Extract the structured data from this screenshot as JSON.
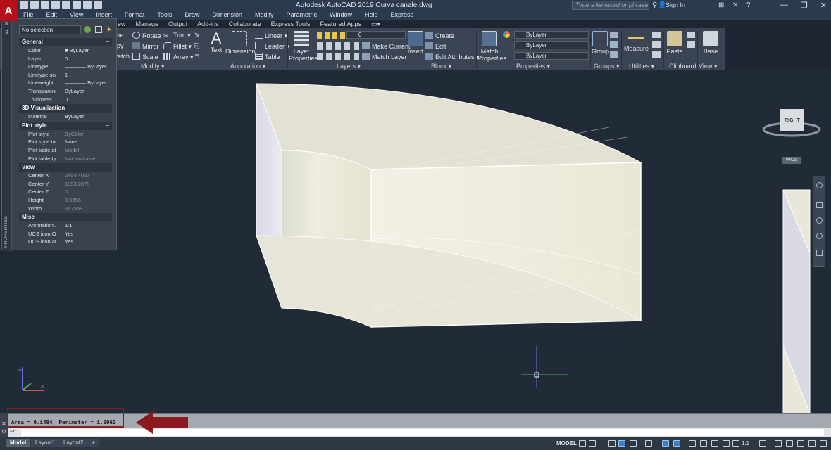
{
  "app": {
    "title": "Autodesk AutoCAD 2019    Curva canale.dwg",
    "logo_letter": "A",
    "search_placeholder": "Type a keyword or phrase",
    "signin_label": "Sign In"
  },
  "menu": [
    "File",
    "Edit",
    "View",
    "Insert",
    "Format",
    "Tools",
    "Draw",
    "Dimension",
    "Modify",
    "Parametric",
    "Window",
    "Help",
    "Express"
  ],
  "ribbon_tabs": [
    "ew",
    "Manage",
    "Output",
    "Add-ins",
    "Collaborate",
    "Express Tools",
    "Featured Apps"
  ],
  "ribbon": {
    "modify": {
      "title": "Modify ▾",
      "items": [
        "ve",
        "Rotate",
        "Trim ▾",
        "py",
        "Mirror",
        "Fillet ▾",
        "retch",
        "Scale",
        "Array ▾"
      ]
    },
    "annotation": {
      "title": "Annotation ▾",
      "text_label": "Text",
      "dimension_label": "Dimension",
      "linear_label": "Linear ▾",
      "leader_label": "Leader ▾",
      "table_label": "Table"
    },
    "layers": {
      "title": "Layers ▾",
      "layer_properties_label": "Layer Properties",
      "current_layer": "0",
      "make_current_label": "Make Current",
      "match_layer_label": "Match Layer"
    },
    "block": {
      "title": "Block ▾",
      "insert_label": "Insert",
      "create_label": "Create",
      "edit_label": "Edit",
      "edit_attributes_label": "Edit Attributes ▾"
    },
    "properties": {
      "title": "Properties ▾",
      "match_properties_label": "Match Properties",
      "color_value": "ByLayer",
      "linetype_value": "ByLayer",
      "lineweight_value": "ByLayer"
    },
    "groups": {
      "title": "Groups ▾",
      "group_label": "Group"
    },
    "utilities": {
      "title": "Utilities ▾",
      "measure_label": "Measure"
    },
    "clipboard": {
      "title": "Clipboard",
      "paste_label": "Paste"
    },
    "view": {
      "title": "View ▾",
      "base_label": "Base"
    }
  },
  "properties_palette": {
    "selection": "No selection",
    "side_label": "PROPERTIES",
    "sections": [
      {
        "title": "General",
        "rows": [
          {
            "k": "Color",
            "v": "■ ByLayer",
            "dim": false
          },
          {
            "k": "Layer",
            "v": "0",
            "dim": false
          },
          {
            "k": "Linetype",
            "v": "———— ByLayer",
            "dim": false
          },
          {
            "k": "Linetype sca...",
            "v": "1",
            "dim": false
          },
          {
            "k": "Lineweight",
            "v": "———— ByLayer",
            "dim": false
          },
          {
            "k": "Transparency",
            "v": "ByLayer",
            "dim": false
          },
          {
            "k": "Thickness",
            "v": "0",
            "dim": false
          }
        ]
      },
      {
        "title": "3D Visualization",
        "rows": [
          {
            "k": "Material",
            "v": "ByLayer",
            "dim": false
          }
        ]
      },
      {
        "title": "Plot style",
        "rows": [
          {
            "k": "Plot style",
            "v": "ByColor",
            "dim": true
          },
          {
            "k": "Plot style ta...",
            "v": "None",
            "dim": false
          },
          {
            "k": "Plot table at...",
            "v": "Model",
            "dim": true
          },
          {
            "k": "Plot table ty...",
            "v": "Not available",
            "dim": true
          }
        ]
      },
      {
        "title": "View",
        "rows": [
          {
            "k": "Center X",
            "v": "2454.4027",
            "dim": true
          },
          {
            "k": "Center Y",
            "v": "1093.2879",
            "dim": true
          },
          {
            "k": "Center Z",
            "v": "0",
            "dim": true
          },
          {
            "k": "Height",
            "v": "0.6056",
            "dim": true
          },
          {
            "k": "Width",
            "v": "-0.7559",
            "dim": true
          }
        ]
      },
      {
        "title": "Misc",
        "rows": [
          {
            "k": "Annotation...",
            "v": "1:1",
            "dim": false
          },
          {
            "k": "UCS icon On",
            "v": "Yes",
            "dim": false
          },
          {
            "k": "UCS icon at...",
            "v": "Yes",
            "dim": false
          }
        ]
      }
    ]
  },
  "viewcube": {
    "face_label": "RIGHT",
    "ucs_label": "WCS"
  },
  "command": {
    "history_text": "Area = 0.1484, Perimeter = 1.5962",
    "input_placeholder": ""
  },
  "status": {
    "layout_tabs": [
      "Model",
      "Layout1",
      "Layout2",
      "+"
    ],
    "model_label": "MODEL",
    "scale_label": "1:1"
  },
  "colors": {
    "canvas_bg": "#212b38",
    "solid_face": "#ecebdc",
    "highlight_red": "#8b1a1f"
  }
}
